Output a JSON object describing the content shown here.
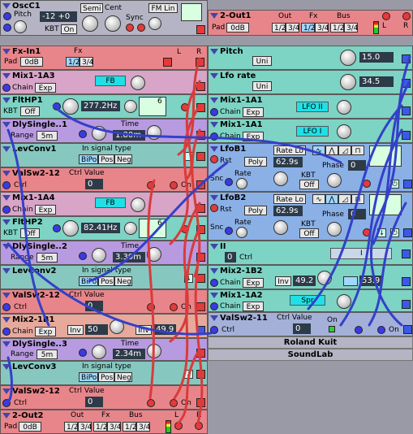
{
  "oscc1": {
    "title": "OscC1",
    "pitch_label": "Pitch",
    "value": "-12 +0",
    "semi": "Semi",
    "cent": "Cent",
    "kbt": "KBT",
    "kbt_value": "On",
    "fm": "FM Lin",
    "sync": "Sync"
  },
  "out1": {
    "title": "2-Out1",
    "pad": "Pad",
    "pad_value": "0dB",
    "out": "Out",
    "fx": "Fx",
    "bus": "Bus",
    "opts": [
      "1/2",
      "3/4",
      "1/2",
      "3/4",
      "1/2",
      "3/4"
    ],
    "l": "L",
    "r": "R"
  },
  "fxin1": {
    "title": "Fx-In1",
    "pad": "Pad",
    "pad_value": "0dB",
    "fx": "Fx",
    "opts": [
      "1/2",
      "3/4"
    ],
    "l": "L",
    "r": "R"
  },
  "pitch": {
    "title": "Pitch",
    "uni": "Uni",
    "value": "15.0"
  },
  "mix1a3": {
    "title": "Mix1-1A3",
    "chain": "Chain",
    "exp": "Exp",
    "fb": "FB"
  },
  "lforate": {
    "title": "Lfo rate",
    "uni": "Uni",
    "value": "34.5"
  },
  "flthp1": {
    "title": "FltHP1",
    "kbt": "KBT",
    "kbt_value": "Off",
    "freq": "277.2Hz",
    "slope": "6"
  },
  "mix1a1a": {
    "title": "Mix1-1A1",
    "chain": "Chain",
    "exp": "Exp",
    "btn": "LFO II"
  },
  "dly1": {
    "title": "DlySingle..1",
    "range": "Range",
    "range_value": "5m",
    "time_label": "Time",
    "time": "1.80m"
  },
  "mix1a1b": {
    "title": "Mix1-1A1",
    "chain": "Chain",
    "exp": "Exp",
    "btn": "LFO I"
  },
  "levconv1": {
    "title": "LevConv1",
    "signal": "In signal type",
    "opts": [
      "BiPol",
      "Pos",
      "Neg"
    ]
  },
  "lfob1": {
    "title": "LfoB1",
    "rate_mode": "Rate Lo",
    "rst": "Rst",
    "poly": "Poly",
    "rate": "62.9s",
    "phase_label": "Phase",
    "phase": "0",
    "kbt": "KBT",
    "kbt_value": "Off",
    "snc": "Snc",
    "rate_label": "Rate"
  },
  "valsw1": {
    "title": "ValSw2-12",
    "ctrl_value": "Ctrl Value",
    "ctrl": "Ctrl",
    "value": "0",
    "on": "On"
  },
  "mix1a4": {
    "title": "Mix1-1A4",
    "chain": "Chain",
    "exp": "Exp",
    "fb": "FB"
  },
  "lfob2": {
    "title": "LfoB2",
    "rate_mode": "Rate Lo",
    "rst": "Rst",
    "poly": "Poly",
    "rate": "62.9s",
    "phase_label": "Phase",
    "phase": "0",
    "kbt": "KBT",
    "kbt_value": "Off",
    "snc": "Snc",
    "rate_label": "Rate"
  },
  "flthp2": {
    "title": "FltHP2",
    "kbt": "KBT",
    "kbt_value": "Off",
    "freq": "82.41Hz",
    "slope": "6"
  },
  "dly2": {
    "title": "DlySingle..2",
    "range": "Range",
    "range_value": "5m",
    "time_label": "Time",
    "time": "3.39m"
  },
  "ctrl2": {
    "title": "II",
    "value": "0",
    "ctrl": "Ctrl",
    "btn": "I"
  },
  "levconv2": {
    "title": "LevConv2",
    "signal": "In signal type",
    "opts": [
      "BiPol",
      "Pos",
      "Neg"
    ]
  },
  "mix2b2": {
    "title": "Mix2-1B2",
    "chain": "Chain",
    "exp": "Exp",
    "inv": "Inv",
    "v1": "49.2",
    "v2": "53.9"
  },
  "valsw2": {
    "title": "ValSw2-12",
    "ctrl_value": "Ctrl Value",
    "ctrl": "Ctrl",
    "value": "0",
    "on": "On"
  },
  "mix1a2": {
    "title": "Mix1-1A2",
    "chain": "Chain",
    "exp": "Exp",
    "btn": "Spr"
  },
  "mix2b1": {
    "title": "Mix2-1B1",
    "chain": "Chain",
    "exp": "Exp",
    "inv": "Inv",
    "v1": "50",
    "v2": "49.9"
  },
  "valsw11": {
    "title": "ValSw2-11",
    "ctrl_value": "Ctrl Value",
    "ctrl": "Ctrl",
    "value": "0",
    "on": "On"
  },
  "dly3": {
    "title": "DlySingle..3",
    "range": "Range",
    "range_value": "5m",
    "time_label": "Time",
    "time": "2.34m"
  },
  "credit1": "Roland Kuit",
  "credit2": "SoundLab",
  "levconv3": {
    "title": "LevConv3",
    "signal": "In signal type",
    "opts": [
      "BiPol",
      "Pos",
      "Neg"
    ]
  },
  "valsw3": {
    "title": "ValSw2-12",
    "ctrl_value": "Ctrl Value",
    "ctrl": "Ctrl",
    "value": "0",
    "on": "On"
  },
  "out2": {
    "title": "2-Out2",
    "pad": "Pad",
    "pad_value": "0dB",
    "out": "Out",
    "fx": "Fx",
    "bus": "Bus",
    "opts": [
      "1/2",
      "3/4",
      "1/2",
      "3/4",
      "1/2",
      "3/4"
    ],
    "l": "L",
    "r": "R"
  }
}
